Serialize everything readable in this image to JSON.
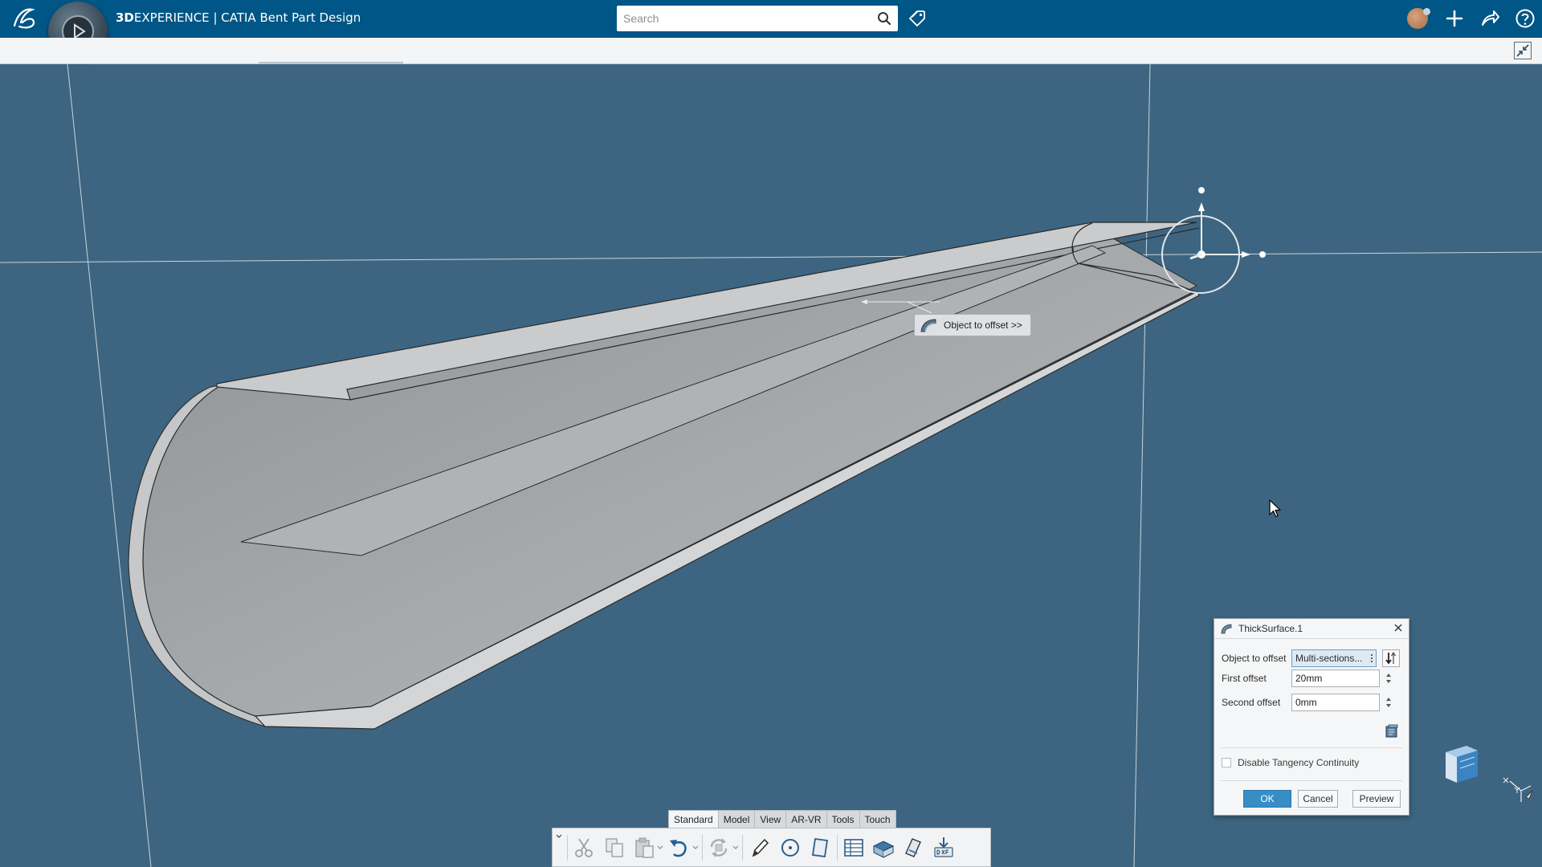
{
  "app": {
    "brand": "3D",
    "product": "EXPERIENCE",
    "separator": " | ",
    "module": "CATIA Bent Part Design",
    "colors": {
      "topbar": "#005686",
      "viewport": "#3d6581",
      "part": "#b4b6b8",
      "accent": "#368ec4"
    }
  },
  "search": {
    "placeholder": "Search"
  },
  "viewport": {
    "tooltip": "Object to offset >>"
  },
  "dialog": {
    "title": "ThickSurface.1",
    "object_label": "Object to offset",
    "object_value": "Multi-sections...",
    "first_label": "First offset",
    "first_value": "20mm",
    "second_label": "Second offset",
    "second_value": "0mm",
    "tangency_label": "Disable Tangency Continuity",
    "tangency_checked": false,
    "ok_label": "OK",
    "cancel_label": "Cancel",
    "preview_label": "Preview"
  },
  "action_bar": {
    "tabs": [
      "Standard",
      "Model",
      "View",
      "AR-VR",
      "Tools",
      "Touch"
    ],
    "active_tab": "Standard",
    "tools": [
      "cut-icon",
      "copy-icon",
      "paste-icon",
      "undo-icon",
      "update-icon",
      "sketch-pencil-icon",
      "circle-icon",
      "plane-icon",
      "table-icon",
      "unfold-icon",
      "fold-icon",
      "dxf-export-icon"
    ]
  }
}
